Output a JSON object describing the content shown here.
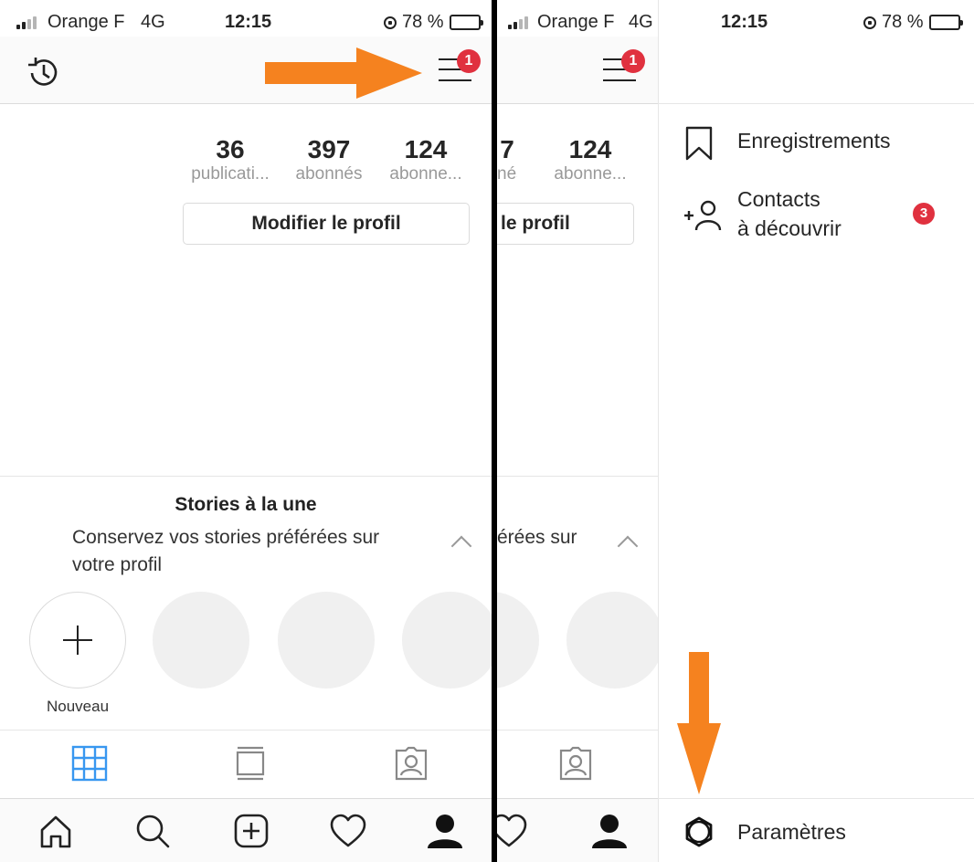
{
  "status_bar": {
    "carrier": "Orange F",
    "network": "4G",
    "time": "12:15",
    "battery": "78 %",
    "battery_level": 0.78
  },
  "profile": {
    "menu_badge": "1",
    "stats": [
      {
        "value": "36",
        "label": "publicati..."
      },
      {
        "value": "397",
        "label": "abonnés"
      },
      {
        "value": "124",
        "label": "abonne..."
      }
    ],
    "edit_button": "Modifier le profil",
    "stories": {
      "title": "Stories à la une",
      "description_line1": "Conservez vos stories préférées sur",
      "description_line2": "votre profil",
      "new_label": "Nouveau"
    }
  },
  "partial": {
    "stat_fragment_1": "7",
    "stat_value_2": "124",
    "label_fragment_1": "nés",
    "label_2": "abonne...",
    "edit_fragment": "le profil",
    "desc_fragment": "érées sur"
  },
  "drawer": {
    "items": [
      {
        "label": "Enregistrements",
        "icon": "bookmark-icon"
      },
      {
        "label_line1": "Contacts",
        "label_line2": "à découvrir",
        "icon": "add-user-icon",
        "badge": "3"
      }
    ],
    "settings_label": "Paramètres"
  },
  "colors": {
    "badge": "#e0313f",
    "arrow": "#f5821f",
    "active_tab": "#3897f0"
  }
}
